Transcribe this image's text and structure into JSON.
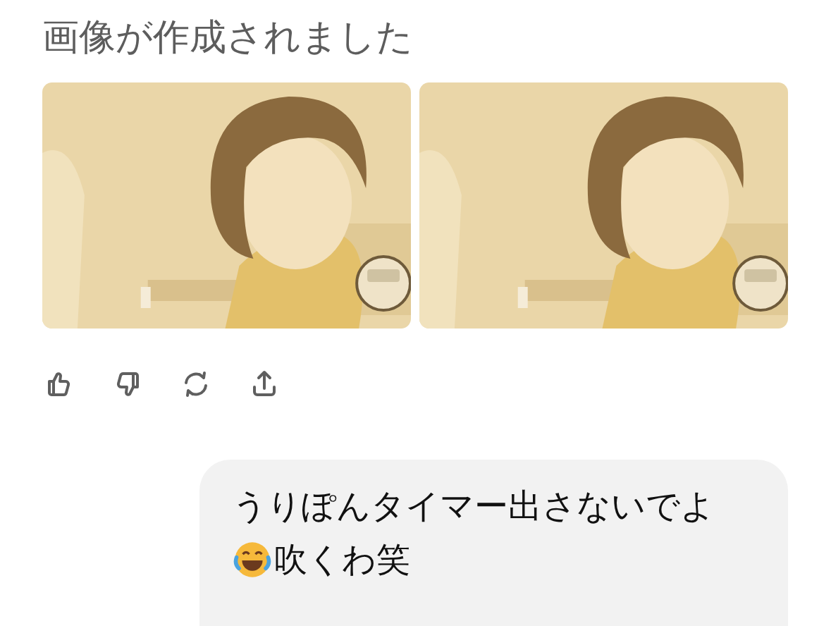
{
  "heading": "画像が作成されました",
  "actions": [
    {
      "kind": "like"
    },
    {
      "kind": "dislike"
    },
    {
      "kind": "regenerate"
    },
    {
      "kind": "share"
    }
  ],
  "user_message": {
    "lines": [
      {
        "kind": "text",
        "text": "うりぽんタイマー出さないでよ"
      },
      {
        "kind": "emoji-text",
        "text": "吹くわ笑"
      }
    ]
  }
}
